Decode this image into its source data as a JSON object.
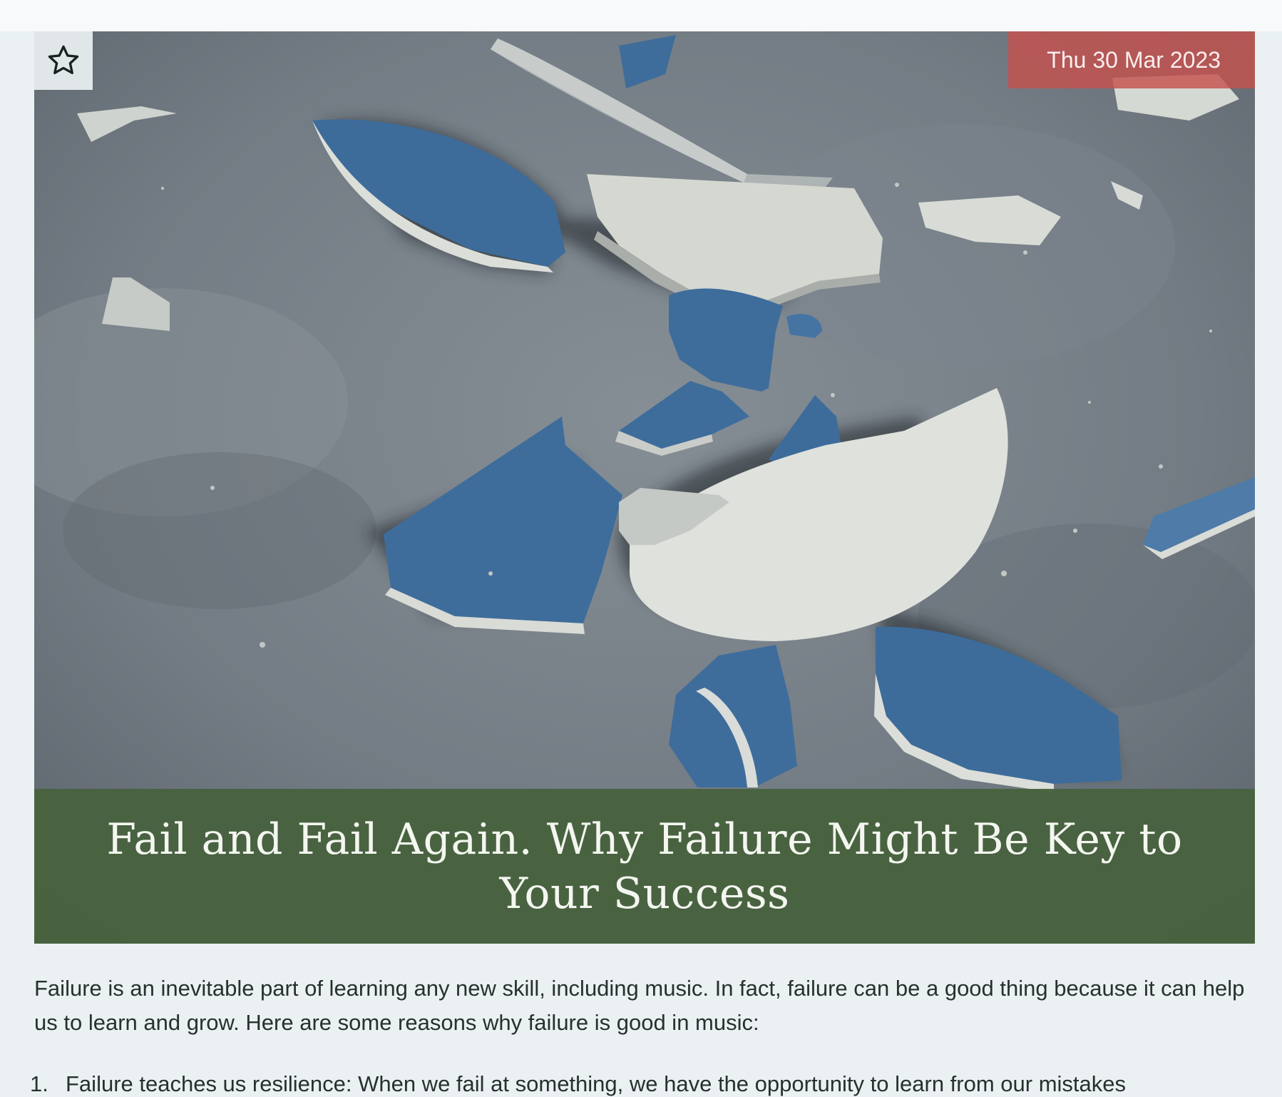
{
  "article": {
    "date": "Thu 30 Mar 2023",
    "title": "Fail and Fail Again. Why Failure Might Be Key to Your Success",
    "intro": "Failure is an inevitable part of learning any new skill, including music. In fact, failure can be a good thing because it can help us to learn and grow. Here are some reasons why failure is good in music:",
    "list": [
      {
        "number": "1.",
        "text": "Failure teaches us resilience: When we fail at something, we have the opportunity to learn from our mistakes"
      }
    ]
  },
  "icons": {
    "favorite": "star-icon",
    "hero": "broken-plate-photo"
  },
  "colors": {
    "date_badge": "#c4524e",
    "title_band": "#48623e",
    "page_background": "#ebf1f2",
    "plate_blue": "#3e6d9c",
    "plate_white": "#dcdfd9"
  }
}
